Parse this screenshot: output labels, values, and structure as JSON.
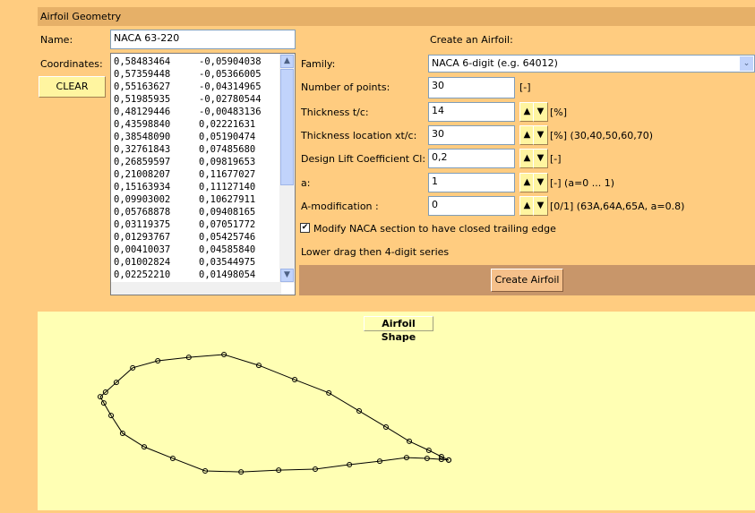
{
  "header": {
    "title": "Airfoil Geometry"
  },
  "name": {
    "label": "Name:",
    "value": "NACA 63-220"
  },
  "coordinates": {
    "label": "Coordinates:",
    "clear_label": "CLEAR",
    "rows": [
      [
        "0,58483464",
        "-0,05904038"
      ],
      [
        "0,57359448",
        "-0,05366005"
      ],
      [
        "0,55163627",
        "-0,04314965"
      ],
      [
        "0,51985935",
        "-0,02780544"
      ],
      [
        "0,48129446",
        "-0,00483136"
      ],
      [
        "0,43598840",
        "0,02221631"
      ],
      [
        "0,38548090",
        "0,05190474"
      ],
      [
        "0,32761843",
        "0,07485680"
      ],
      [
        "0,26859597",
        "0,09819653"
      ],
      [
        "0,21008207",
        "0,11677027"
      ],
      [
        "0,15163934",
        "0,11127140"
      ],
      [
        "0,09903002",
        "0,10627911"
      ],
      [
        "0,05768878",
        "0,09408165"
      ],
      [
        "0,03119375",
        "0,07051772"
      ],
      [
        "0,01293767",
        "0,05425746"
      ],
      [
        "0,00410037",
        "0,04585840"
      ],
      [
        "0,01002824",
        "0,03544975"
      ],
      [
        "0,02252210",
        "0,01498054"
      ]
    ]
  },
  "create": {
    "heading": "Create an Airfoil:",
    "family_label": "Family:",
    "family_value": "NACA 6-digit (e.g. 64012)",
    "fields": [
      {
        "label": "Number of points:",
        "value": "30",
        "unit": "[-]",
        "spinner": false
      },
      {
        "label": "Thickness  t/c:",
        "value": "14",
        "unit": "[%]",
        "spinner": true
      },
      {
        "label": "Thickness location  xt/c:",
        "value": "30",
        "unit": "[%]  (30,40,50,60,70)",
        "spinner": true
      },
      {
        "label": "Design Lift Coefficient  Cl:",
        "value": "0,2",
        "unit": "[-]",
        "spinner": true
      },
      {
        "label": "a:",
        "value": "1",
        "unit": "[-]  (a=0 ... 1)",
        "spinner": true
      },
      {
        "label": "A-modification  :",
        "value": "0",
        "unit": "[0/1]  (63A,64A,65A, a=0.8)",
        "spinner": true
      }
    ],
    "checkbox_label": "Modify NACA section to have closed trailing edge",
    "checkbox_checked": true,
    "note": "Lower drag then 4-digit series",
    "button": "Create Airfoil"
  },
  "plot": {
    "title": "Airfoil Shape",
    "points": [
      [
        1.0,
        -0.118
      ],
      [
        0.979,
        -0.108
      ],
      [
        0.943,
        -0.09
      ],
      [
        0.887,
        -0.064
      ],
      [
        0.82,
        -0.023
      ],
      [
        0.743,
        0.023
      ],
      [
        0.656,
        0.075
      ],
      [
        0.558,
        0.113
      ],
      [
        0.455,
        0.154
      ],
      [
        0.355,
        0.185
      ],
      [
        0.254,
        0.177
      ],
      [
        0.165,
        0.167
      ],
      [
        0.093,
        0.147
      ],
      [
        0.046,
        0.105
      ],
      [
        0.015,
        0.077
      ],
      [
        0.0,
        0.064
      ],
      [
        0.01,
        0.046
      ],
      [
        0.031,
        0.01
      ],
      [
        0.064,
        -0.041
      ],
      [
        0.126,
        -0.08
      ],
      [
        0.208,
        -0.113
      ],
      [
        0.301,
        -0.149
      ],
      [
        0.404,
        -0.152
      ],
      [
        0.512,
        -0.147
      ],
      [
        0.617,
        -0.144
      ],
      [
        0.715,
        -0.131
      ],
      [
        0.802,
        -0.121
      ],
      [
        0.879,
        -0.111
      ],
      [
        0.938,
        -0.113
      ],
      [
        0.979,
        -0.116
      ],
      [
        1.0,
        -0.118
      ]
    ]
  }
}
